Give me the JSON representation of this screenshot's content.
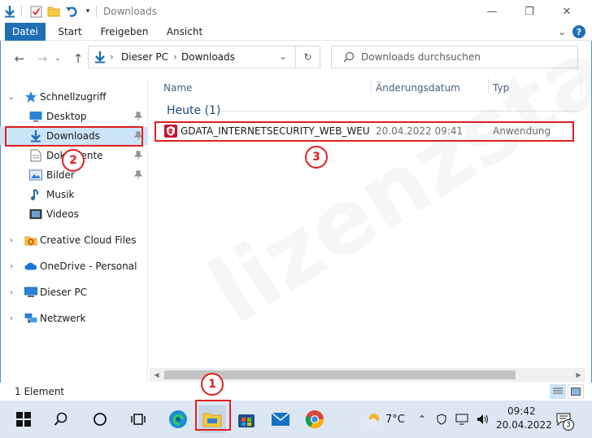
{
  "window": {
    "title": "Downloads",
    "minimize": "—",
    "maximize": "❐",
    "close": "✕"
  },
  "ribbon": {
    "tabs": [
      "Datei",
      "Start",
      "Freigeben",
      "Ansicht"
    ],
    "collapse_glyph": "⌄",
    "help_glyph": "?"
  },
  "navigation": {
    "back": "←",
    "forward": "→",
    "up": "↑",
    "breadcrumb": [
      "Dieser PC",
      "Downloads"
    ],
    "breadcrumb_sep": "›",
    "dropdown": "⌄",
    "refresh": "↻",
    "search_placeholder": "Downloads durchsuchen"
  },
  "sidebar": {
    "quick_access": "Schnellzugriff",
    "items": [
      {
        "label": "Desktop",
        "icon": "desktop-icon",
        "pinned": true
      },
      {
        "label": "Downloads",
        "icon": "download-arrow-icon",
        "pinned": true,
        "selected": true
      },
      {
        "label": "Dokumente",
        "icon": "documents-icon",
        "pinned": true
      },
      {
        "label": "Bilder",
        "icon": "pictures-icon",
        "pinned": true
      },
      {
        "label": "Musik",
        "icon": "music-icon",
        "pinned": false
      },
      {
        "label": "Videos",
        "icon": "videos-icon",
        "pinned": false
      }
    ],
    "roots": [
      {
        "label": "Creative Cloud Files",
        "icon": "creative-cloud-icon"
      },
      {
        "label": "OneDrive - Personal",
        "icon": "onedrive-icon"
      },
      {
        "label": "Dieser PC",
        "icon": "this-pc-icon"
      },
      {
        "label": "Netzwerk",
        "icon": "network-icon"
      }
    ]
  },
  "file_list": {
    "columns": [
      "Name",
      "Änderungsdatum",
      "Typ"
    ],
    "group": "Heute (1)",
    "rows": [
      {
        "name": "GDATA_INTERNETSECURITY_WEB_WEU",
        "date": "20.04.2022 09:41",
        "type": "Anwendung",
        "icon": "gdata-shield-icon"
      }
    ]
  },
  "status": {
    "count": "1 Element"
  },
  "taskbar": {
    "weather": "7°C",
    "time": "09:42",
    "date": "20.04.2022",
    "notifications": "3"
  },
  "annotations": [
    "1",
    "2",
    "3"
  ],
  "watermark": "lizenzstar.de",
  "colors": {
    "accent": "#1f6fb5",
    "selection": "#cce4f7",
    "annotation": "#e02020",
    "taskbar": "#dde7f3"
  }
}
